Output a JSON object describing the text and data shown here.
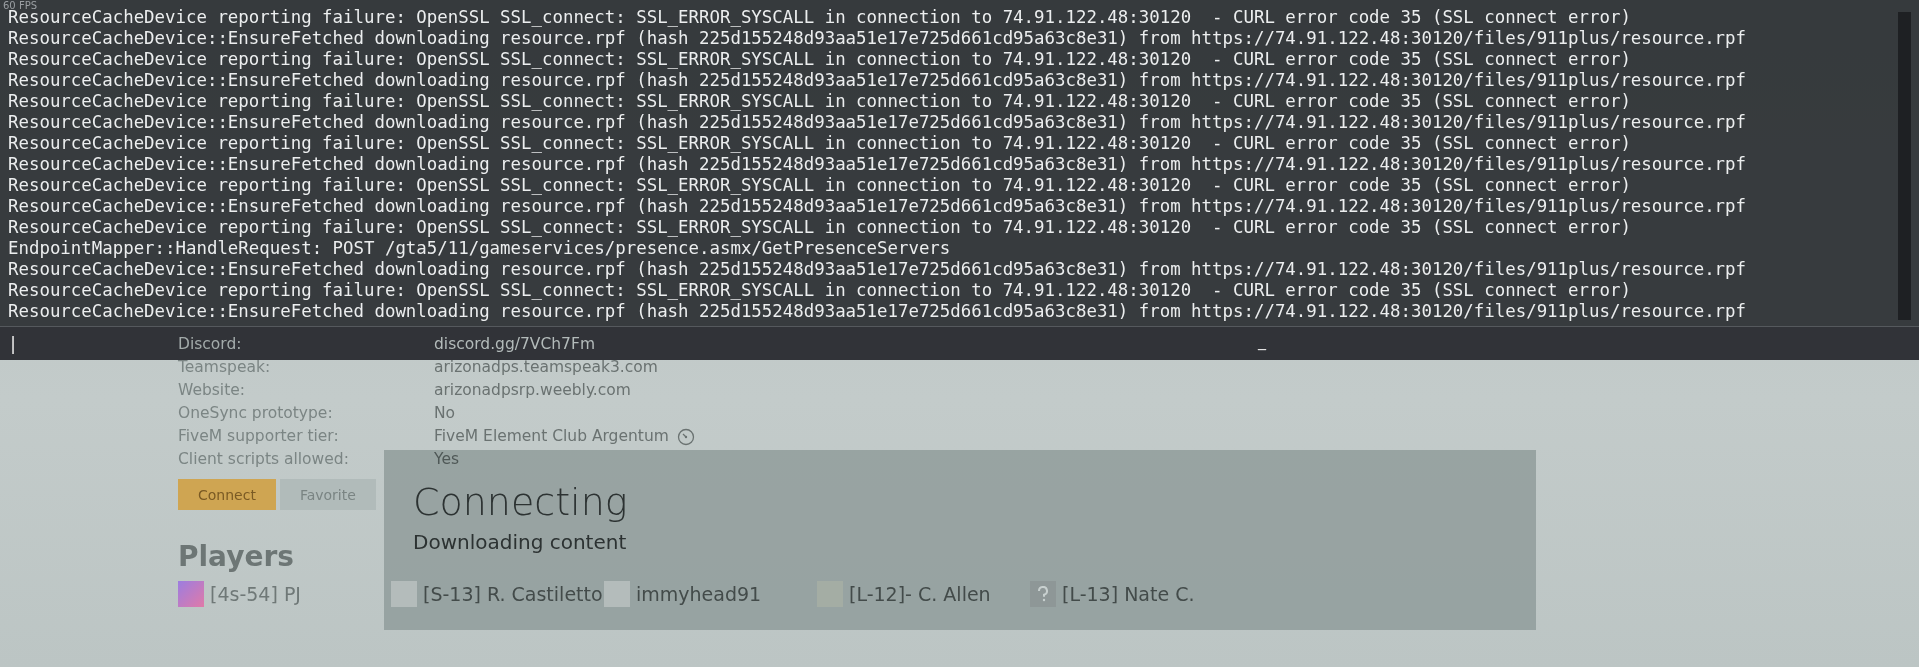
{
  "fps_counter": "60 FPS",
  "console": {
    "lines": [
      "ResourceCacheDevice reporting failure: OpenSSL SSL_connect: SSL_ERROR_SYSCALL in connection to 74.91.122.48:30120  - CURL error code 35 (SSL connect error)",
      "ResourceCacheDevice::EnsureFetched downloading resource.rpf (hash 225d155248d93aa51e17e725d661cd95a63c8e31) from https://74.91.122.48:30120/files/911plus/resource.rpf",
      "ResourceCacheDevice reporting failure: OpenSSL SSL_connect: SSL_ERROR_SYSCALL in connection to 74.91.122.48:30120  - CURL error code 35 (SSL connect error)",
      "ResourceCacheDevice::EnsureFetched downloading resource.rpf (hash 225d155248d93aa51e17e725d661cd95a63c8e31) from https://74.91.122.48:30120/files/911plus/resource.rpf",
      "ResourceCacheDevice reporting failure: OpenSSL SSL_connect: SSL_ERROR_SYSCALL in connection to 74.91.122.48:30120  - CURL error code 35 (SSL connect error)",
      "ResourceCacheDevice::EnsureFetched downloading resource.rpf (hash 225d155248d93aa51e17e725d661cd95a63c8e31) from https://74.91.122.48:30120/files/911plus/resource.rpf",
      "ResourceCacheDevice reporting failure: OpenSSL SSL_connect: SSL_ERROR_SYSCALL in connection to 74.91.122.48:30120  - CURL error code 35 (SSL connect error)",
      "ResourceCacheDevice::EnsureFetched downloading resource.rpf (hash 225d155248d93aa51e17e725d661cd95a63c8e31) from https://74.91.122.48:30120/files/911plus/resource.rpf",
      "ResourceCacheDevice reporting failure: OpenSSL SSL_connect: SSL_ERROR_SYSCALL in connection to 74.91.122.48:30120  - CURL error code 35 (SSL connect error)",
      "ResourceCacheDevice::EnsureFetched downloading resource.rpf (hash 225d155248d93aa51e17e725d661cd95a63c8e31) from https://74.91.122.48:30120/files/911plus/resource.rpf",
      "ResourceCacheDevice reporting failure: OpenSSL SSL_connect: SSL_ERROR_SYSCALL in connection to 74.91.122.48:30120  - CURL error code 35 (SSL connect error)",
      "EndpointMapper::HandleRequest: POST /gta5/11/gameservices/presence.asmx/GetPresenceServers",
      "ResourceCacheDevice::EnsureFetched downloading resource.rpf (hash 225d155248d93aa51e17e725d661cd95a63c8e31) from https://74.91.122.48:30120/files/911plus/resource.rpf",
      "ResourceCacheDevice reporting failure: OpenSSL SSL_connect: SSL_ERROR_SYSCALL in connection to 74.91.122.48:30120  - CURL error code 35 (SSL connect error)",
      "ResourceCacheDevice::EnsureFetched downloading resource.rpf (hash 225d155248d93aa51e17e725d661cd95a63c8e31) from https://74.91.122.48:30120/files/911plus/resource.rpf"
    ],
    "input_cursor": "|",
    "input_marker": "_"
  },
  "server_info": [
    {
      "label": "Discord:",
      "value": "discord.gg/7VCh7Fm"
    },
    {
      "label": "Teamspeak:",
      "value": "arizonadps.teamspeak3.com"
    },
    {
      "label": "Website:",
      "value": "arizonadpsrp.weebly.com"
    },
    {
      "label": "OneSync prototype:",
      "value": "No"
    },
    {
      "label": "FiveM supporter tier:",
      "value": "FiveM Element Club Argentum"
    },
    {
      "label": "Client scripts allowed:",
      "value": "Yes"
    }
  ],
  "buttons": [
    {
      "label": "Connect",
      "kind": "primary"
    },
    {
      "label": "Favorite",
      "kind": "secondary"
    }
  ],
  "players": {
    "title": "Players",
    "items": [
      {
        "name": "[4s-54] PJ",
        "kind": "gradient"
      },
      {
        "name": "[S-13] R. Castiletto",
        "kind": "photo"
      },
      {
        "name": "immyhead91",
        "kind": "photo"
      },
      {
        "name": "[L-12]- C. Allen",
        "kind": "badge"
      },
      {
        "name": "[L-13] Nate C.",
        "kind": "unknown"
      }
    ]
  },
  "dialog": {
    "title": "Connecting",
    "message": "Downloading content"
  }
}
